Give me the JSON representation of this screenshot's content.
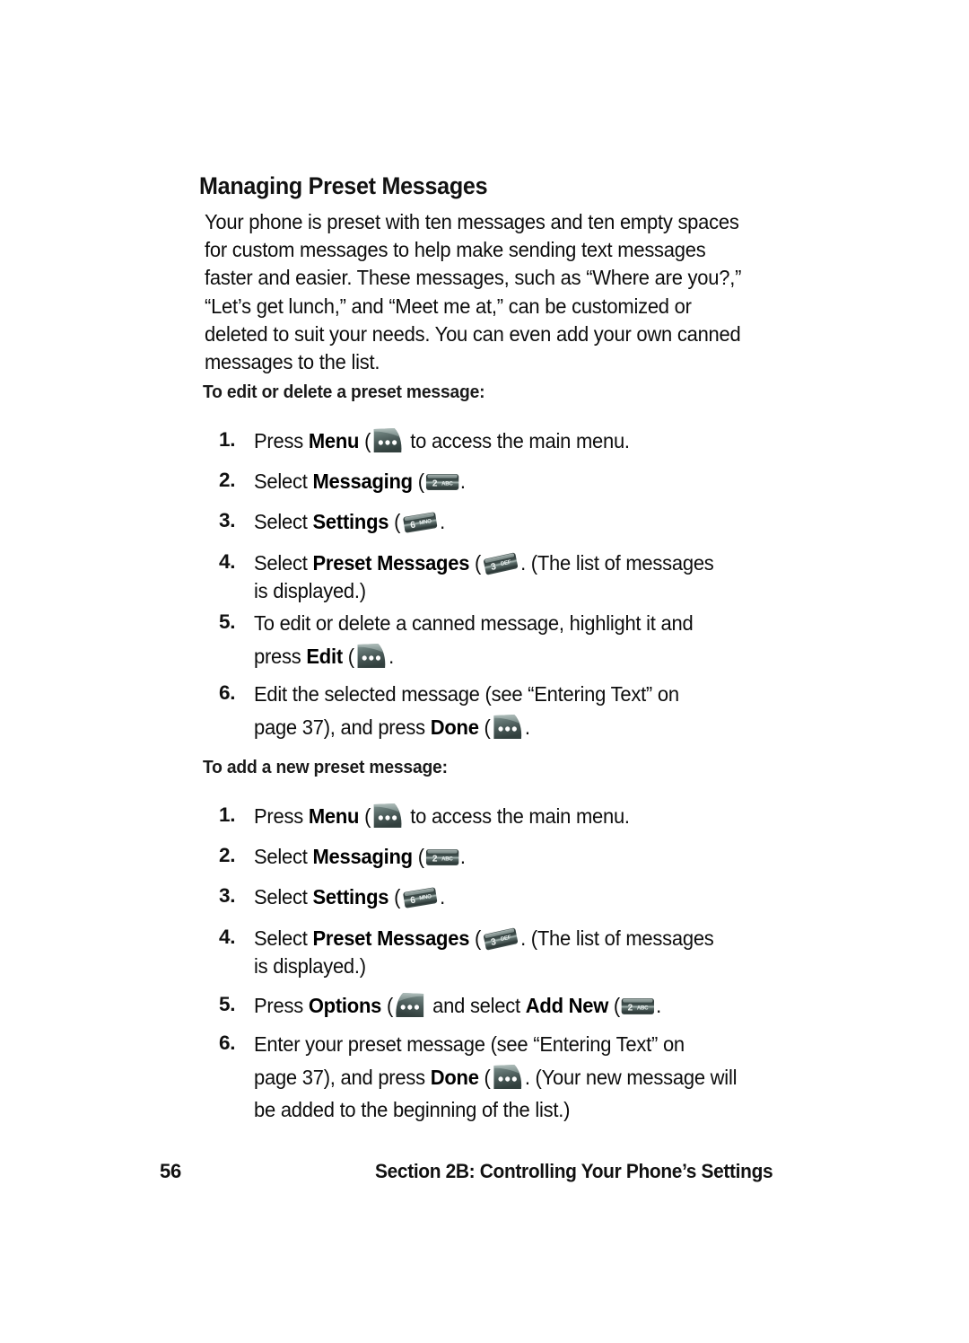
{
  "document": {
    "heading": "Managing Preset Messages",
    "intro_lines": [
      "Your phone is preset with ten messages and ten empty spaces",
      "for custom messages to help make sending text messages",
      "faster and easier. These messages, such as “Where are you?,”",
      "“Let’s get lunch,” and “Meet me at,” can be customized or",
      "deleted to suit your needs. You can even add your own canned",
      "messages to the list."
    ]
  },
  "procedure_edit": {
    "subheading": "To edit or delete a preset message:",
    "steps": [
      {
        "number": "1.",
        "pre": "Press ",
        "bold": "Menu",
        "post": " to access the main menu.",
        "icon": "softkey-left-menu-icon",
        "icon_label": "Menu"
      },
      {
        "number": "2.",
        "pre": "Select ",
        "bold": "Messaging",
        "post": ".",
        "icon": "key-2-abc-icon",
        "icon_label": "2 ABC"
      },
      {
        "number": "3.",
        "pre": "Select ",
        "bold": "Settings",
        "post": ".",
        "icon": "key-6-mno-icon",
        "icon_label": "6 MNO"
      },
      {
        "number": "4.",
        "pre": "Select ",
        "bold": "Preset Messages",
        "post": ". (The list of messages",
        "post2": "is displayed.)",
        "icon": "key-3-def-icon",
        "icon_label": "3 DEF"
      },
      {
        "number": "5.",
        "line1": "To edit or delete a canned message, highlight it and",
        "pre2": "press ",
        "bold2": "Edit",
        "post2": ".",
        "icon": "softkey-left-edit-icon",
        "icon_label": "Edit"
      },
      {
        "number": "6.",
        "line1": "Edit the selected message (see “Entering Text” on",
        "pre2": "page 37), and press ",
        "bold2": "Done",
        "post2": ".",
        "icon": "softkey-left-done-icon",
        "icon_label": "Done"
      }
    ]
  },
  "procedure_add": {
    "subheading": "To add a new preset message:",
    "steps": [
      {
        "number": "1.",
        "pre": "Press ",
        "bold": "Menu",
        "post": " to access the main menu.",
        "icon": "softkey-left-menu-icon",
        "icon_label": "Menu"
      },
      {
        "number": "2.",
        "pre": "Select ",
        "bold": "Messaging",
        "post": ".",
        "icon": "key-2-abc-icon",
        "icon_label": "2 ABC"
      },
      {
        "number": "3.",
        "pre": "Select ",
        "bold": "Settings",
        "post": ".",
        "icon": "key-6-mno-icon",
        "icon_label": "6 MNO"
      },
      {
        "number": "4.",
        "pre": "Select ",
        "bold": "Preset Messages",
        "post": ". (The list of messages",
        "post2": "is displayed.)",
        "icon": "key-3-def-icon",
        "icon_label": "3 DEF"
      },
      {
        "number": "5.",
        "pre": "Press ",
        "bold": "Options",
        "mid": " and select ",
        "bold_b": "Add New",
        "post": ".",
        "icon": "softkey-right-options-icon",
        "icon_label": "Options",
        "icon_b": "key-2-abc-icon",
        "icon_b_label": "2 ABC"
      },
      {
        "number": "6.",
        "line1": "Enter your preset message (see “Entering Text” on",
        "pre2": "page 37), and press ",
        "bold2": "Done",
        "post2": ". (Your new message will",
        "line3": "be added to the beginning of the list.)",
        "icon": "softkey-left-done-icon",
        "icon_label": "Done"
      }
    ]
  },
  "footer": {
    "page_number": "56",
    "section": "Section 2B: Controlling Your Phone’s Settings"
  },
  "colors": {
    "page_background": "#ffffff",
    "text": "#0d0d0d",
    "key_dark": "#2f3c3c",
    "key_mid": "#5d6f6d",
    "key_light": "#9fb0ad",
    "key_dot": "#ffffff"
  },
  "key_glyphs": {
    "softkey_left": {
      "dots": 3
    },
    "softkey_right": {
      "dots": 3
    },
    "key_2": {
      "digit": "2",
      "letters": "ABC"
    },
    "key_3": {
      "digit": "3",
      "letters": "DEF"
    },
    "key_6": {
      "digit": "6",
      "letters": "MNO"
    }
  }
}
